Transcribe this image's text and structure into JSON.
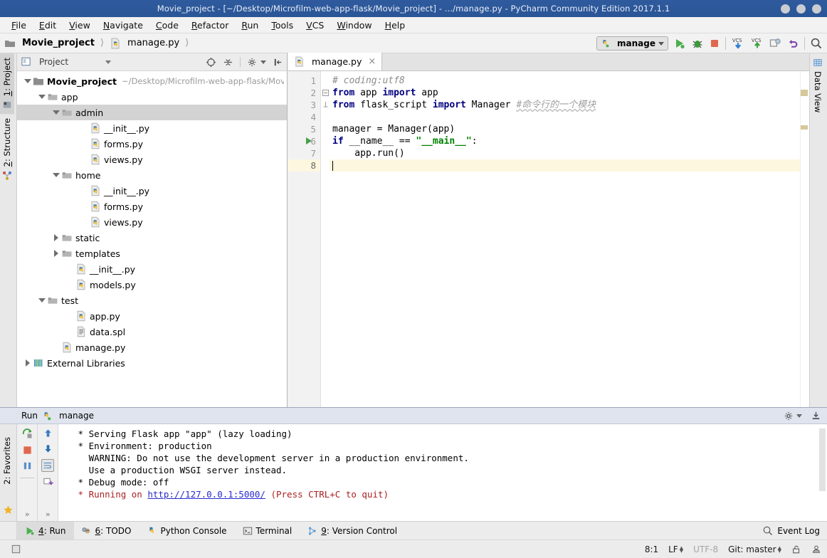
{
  "window": {
    "title": "Movie_project - [~/Desktop/Microfilm-web-app-flask/Movie_project] - .../manage.py - PyCharm Community Edition 2017.1.1"
  },
  "menubar": {
    "items": [
      {
        "label": "File"
      },
      {
        "label": "Edit"
      },
      {
        "label": "View"
      },
      {
        "label": "Navigate"
      },
      {
        "label": "Code"
      },
      {
        "label": "Refactor"
      },
      {
        "label": "Run"
      },
      {
        "label": "Tools"
      },
      {
        "label": "VCS"
      },
      {
        "label": "Window"
      },
      {
        "label": "Help"
      }
    ]
  },
  "breadcrumb": {
    "project": "Movie_project",
    "file": "manage.py"
  },
  "toolbar": {
    "run_config": "manage",
    "run_tooltip": "Run",
    "debug_tooltip": "Debug",
    "stop_tooltip": "Stop",
    "vcs_update_tooltip": "Update Project",
    "vcs_commit_tooltip": "Commit",
    "diff_tooltip": "Compare",
    "revert_tooltip": "Rollback",
    "search_tooltip": "Search Everywhere"
  },
  "left_tool_tabs": [
    {
      "label": "1: Project",
      "active": true,
      "icon": "project-icon"
    },
    {
      "label": "2: Structure",
      "active": false,
      "icon": "structure-icon"
    }
  ],
  "right_tool_tabs": [
    {
      "label": "Data View",
      "active": false,
      "icon": "table-icon"
    }
  ],
  "project_panel": {
    "title": "Project",
    "tree": [
      {
        "label": "Movie_project",
        "path": "~/Desktop/Microfilm-web-app-flask/Mov",
        "indent": 0,
        "twisty": "down",
        "icon": "folder-dark",
        "bold": true,
        "selected": false
      },
      {
        "label": "app",
        "path": "",
        "indent": 1,
        "twisty": "down",
        "icon": "folder",
        "bold": false,
        "selected": false
      },
      {
        "label": "admin",
        "path": "",
        "indent": 2,
        "twisty": "down",
        "icon": "folder",
        "bold": false,
        "selected": true
      },
      {
        "label": "__init__.py",
        "path": "",
        "indent": 4,
        "twisty": "none",
        "icon": "python",
        "bold": false,
        "selected": false
      },
      {
        "label": "forms.py",
        "path": "",
        "indent": 4,
        "twisty": "none",
        "icon": "python",
        "bold": false,
        "selected": false
      },
      {
        "label": "views.py",
        "path": "",
        "indent": 4,
        "twisty": "none",
        "icon": "python",
        "bold": false,
        "selected": false
      },
      {
        "label": "home",
        "path": "",
        "indent": 2,
        "twisty": "down",
        "icon": "folder",
        "bold": false,
        "selected": false
      },
      {
        "label": "__init__.py",
        "path": "",
        "indent": 4,
        "twisty": "none",
        "icon": "python",
        "bold": false,
        "selected": false
      },
      {
        "label": "forms.py",
        "path": "",
        "indent": 4,
        "twisty": "none",
        "icon": "python",
        "bold": false,
        "selected": false
      },
      {
        "label": "views.py",
        "path": "",
        "indent": 4,
        "twisty": "none",
        "icon": "python",
        "bold": false,
        "selected": false
      },
      {
        "label": "static",
        "path": "",
        "indent": 2,
        "twisty": "right",
        "icon": "folder",
        "bold": false,
        "selected": false
      },
      {
        "label": "templates",
        "path": "",
        "indent": 2,
        "twisty": "right",
        "icon": "folder",
        "bold": false,
        "selected": false
      },
      {
        "label": "__init__.py",
        "path": "",
        "indent": 3,
        "twisty": "none",
        "icon": "python",
        "bold": false,
        "selected": false
      },
      {
        "label": "models.py",
        "path": "",
        "indent": 3,
        "twisty": "none",
        "icon": "python",
        "bold": false,
        "selected": false
      },
      {
        "label": "test",
        "path": "",
        "indent": 1,
        "twisty": "down",
        "icon": "folder",
        "bold": false,
        "selected": false
      },
      {
        "label": "app.py",
        "path": "",
        "indent": 3,
        "twisty": "none",
        "icon": "python",
        "bold": false,
        "selected": false
      },
      {
        "label": "data.spl",
        "path": "",
        "indent": 3,
        "twisty": "none",
        "icon": "file",
        "bold": false,
        "selected": false
      },
      {
        "label": "manage.py",
        "path": "",
        "indent": 2,
        "twisty": "none",
        "icon": "python",
        "bold": false,
        "selected": false
      },
      {
        "label": "External Libraries",
        "path": "",
        "indent": 0,
        "twisty": "right",
        "icon": "library",
        "bold": false,
        "selected": false
      }
    ]
  },
  "editor": {
    "tab_label": "manage.py",
    "tab_icon": "python-file-icon",
    "close_label": "×",
    "lines": [
      {
        "num": "1",
        "current": false,
        "runnable": false,
        "fold": "none",
        "tokens": [
          {
            "t": "# coding:utf8",
            "c": "c"
          }
        ]
      },
      {
        "num": "2",
        "current": false,
        "runnable": false,
        "fold": "minus",
        "tokens": [
          {
            "t": "from",
            "c": "k"
          },
          {
            "t": " app ",
            "c": ""
          },
          {
            "t": "import",
            "c": "k"
          },
          {
            "t": " app",
            "c": ""
          }
        ]
      },
      {
        "num": "3",
        "current": false,
        "runnable": false,
        "fold": "end",
        "tokens": [
          {
            "t": "from",
            "c": "k"
          },
          {
            "t": " flask_script ",
            "c": ""
          },
          {
            "t": "import",
            "c": "k"
          },
          {
            "t": " Manager ",
            "c": ""
          },
          {
            "t": "#命令行的一个模块",
            "c": "cwavy"
          }
        ]
      },
      {
        "num": "4",
        "current": false,
        "runnable": false,
        "fold": "none",
        "tokens": [
          {
            "t": "",
            "c": ""
          }
        ]
      },
      {
        "num": "5",
        "current": false,
        "runnable": false,
        "fold": "none",
        "tokens": [
          {
            "t": "manager = Manager(app)",
            "c": ""
          }
        ]
      },
      {
        "num": "6",
        "current": false,
        "runnable": true,
        "fold": "none",
        "tokens": [
          {
            "t": "if",
            "c": "k"
          },
          {
            "t": " __name__ == ",
            "c": ""
          },
          {
            "t": "\"__main__\"",
            "c": "s"
          },
          {
            "t": ":",
            "c": ""
          }
        ]
      },
      {
        "num": "7",
        "current": false,
        "runnable": false,
        "fold": "none",
        "tokens": [
          {
            "t": "    app.run()",
            "c": ""
          }
        ]
      },
      {
        "num": "8",
        "current": true,
        "runnable": false,
        "fold": "none",
        "tokens": [
          {
            "t": "",
            "c": ""
          }
        ]
      }
    ]
  },
  "run_panel": {
    "title": "Run",
    "config_name": "manage",
    "settings_tooltip": "Settings",
    "export_tooltip": "Export to Text File",
    "tools": [
      {
        "name": "rerun-icon",
        "tooltip": "Rerun"
      },
      {
        "name": "stop-icon",
        "tooltip": "Stop"
      },
      {
        "name": "pause-icon",
        "tooltip": "Pause Output"
      },
      {
        "name": "up-arrow-icon",
        "tooltip": "Up the Stack Trace"
      },
      {
        "name": "down-arrow-icon",
        "tooltip": "Down the Stack Trace"
      },
      {
        "name": "soft-wrap-icon",
        "tooltip": "Use Soft Wraps"
      },
      {
        "name": "print-icon",
        "tooltip": "Print"
      }
    ],
    "console": [
      {
        "text": " * Serving Flask app \"app\" (lazy loading)",
        "style": "normal"
      },
      {
        "text": " * Environment: production",
        "style": "normal"
      },
      {
        "text": "   WARNING: Do not use the development server in a production environment.",
        "style": "normal"
      },
      {
        "text": "   Use a production WSGI server instead.",
        "style": "normal"
      },
      {
        "text": " * Debug mode: off",
        "style": "normal"
      },
      {
        "text": " * Running on ",
        "style": "error",
        "link": "http://127.0.0.1:5000/",
        "after": " (Press CTRL+C to quit)"
      }
    ]
  },
  "toolwindow_bar": {
    "tabs": [
      {
        "label": "4: Run",
        "num": "4",
        "rest": ": Run",
        "active": true,
        "icon": "run-icon"
      },
      {
        "label": "6: TODO",
        "num": "6",
        "rest": ": TODO",
        "active": false,
        "icon": "todo-icon"
      },
      {
        "label": "Python Console",
        "num": "",
        "rest": "Python Console",
        "active": false,
        "icon": "python-icon"
      },
      {
        "label": "Terminal",
        "num": "",
        "rest": "Terminal",
        "active": false,
        "icon": "terminal-icon"
      },
      {
        "label": "9: Version Control",
        "num": "9",
        "rest": ": Version Control",
        "active": false,
        "icon": "vcs-icon"
      }
    ],
    "event_log": "Event Log"
  },
  "statusbar": {
    "caret": "8:1",
    "line_separator": "LF",
    "encoding": "UTF-8",
    "branch": "Git: master",
    "lock_tooltip": "Read-only toggle",
    "inspection_tooltip": "Inspections"
  }
}
